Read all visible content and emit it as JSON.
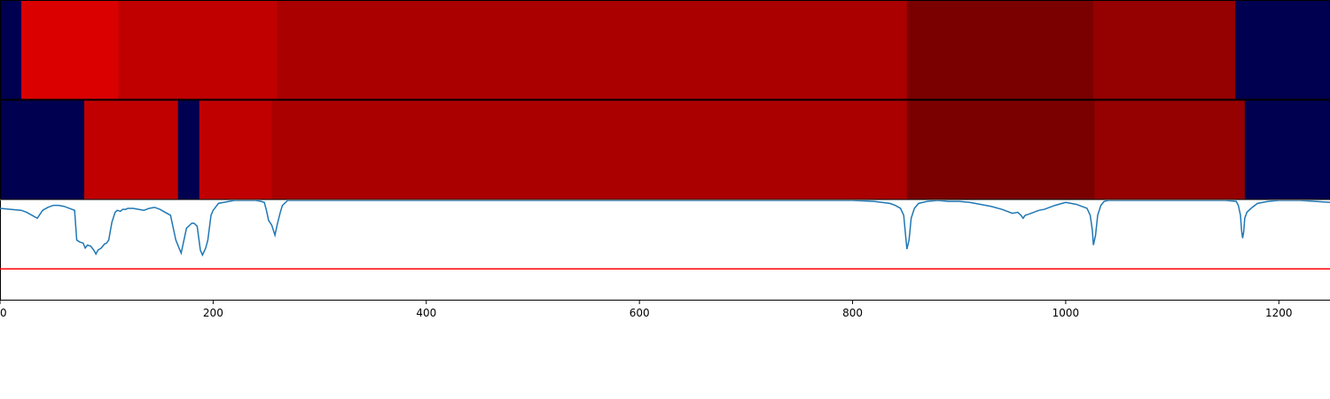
{
  "chart_data": [
    {
      "type": "heatmap",
      "panel": "top",
      "x_range": [
        0,
        1248
      ],
      "segments": [
        {
          "start": 0,
          "end": 20,
          "color": "#000050"
        },
        {
          "start": 20,
          "end": 111,
          "color": "#da0000"
        },
        {
          "start": 111,
          "end": 260,
          "color": "#c00000"
        },
        {
          "start": 260,
          "end": 851,
          "color": "#aa0000"
        },
        {
          "start": 851,
          "end": 1026,
          "color": "#7a0000"
        },
        {
          "start": 1026,
          "end": 1159,
          "color": "#950000"
        },
        {
          "start": 1159,
          "end": 1248,
          "color": "#000050"
        }
      ]
    },
    {
      "type": "heatmap",
      "panel": "middle",
      "x_range": [
        0,
        1248
      ],
      "segments": [
        {
          "start": 0,
          "end": 79,
          "color": "#000050"
        },
        {
          "start": 79,
          "end": 167,
          "color": "#c00000"
        },
        {
          "start": 167,
          "end": 187,
          "color": "#000050"
        },
        {
          "start": 187,
          "end": 255,
          "color": "#c00000"
        },
        {
          "start": 255,
          "end": 851,
          "color": "#aa0000"
        },
        {
          "start": 851,
          "end": 1027,
          "color": "#7a0000"
        },
        {
          "start": 1027,
          "end": 1168,
          "color": "#950000"
        },
        {
          "start": 1168,
          "end": 1248,
          "color": "#000050"
        }
      ]
    },
    {
      "type": "line",
      "panel": "bottom",
      "xlim": [
        0,
        1248
      ],
      "ylim": [
        0,
        1
      ],
      "line_color": "#1f77b4",
      "threshold": {
        "y": 0.31,
        "color": "#ff0000"
      },
      "x_ticks": [
        "0",
        "200",
        "400",
        "600",
        "800",
        "1000",
        "1200"
      ],
      "series": [
        {
          "x": [
            0,
            10,
            20,
            25,
            30,
            35,
            40,
            45,
            50,
            55,
            60,
            65,
            70,
            72,
            75,
            78,
            80,
            82,
            85,
            88,
            90,
            92,
            95,
            98,
            100,
            102,
            105,
            108,
            110,
            113,
            115,
            118,
            120,
            125,
            130,
            135,
            140,
            145,
            150,
            155,
            160,
            163,
            165,
            168,
            170,
            173,
            175,
            178,
            180,
            182,
            185,
            188,
            190,
            193,
            195,
            198,
            200,
            205,
            210,
            215,
            220,
            230,
            240,
            245,
            248,
            250,
            252,
            255,
            258,
            260,
            263,
            265,
            270,
            280,
            300,
            400,
            500,
            600,
            700,
            800,
            820,
            835,
            840,
            845,
            848,
            850,
            851,
            853,
            855,
            858,
            862,
            870,
            880,
            890,
            900,
            910,
            920,
            930,
            940,
            945,
            950,
            955,
            958,
            960,
            962,
            965,
            970,
            975,
            980,
            985,
            990,
            1000,
            1010,
            1015,
            1020,
            1023,
            1025,
            1026,
            1028,
            1030,
            1033,
            1036,
            1040,
            1050,
            1100,
            1150,
            1160,
            1162,
            1164,
            1165,
            1166,
            1167,
            1168,
            1170,
            1172,
            1175,
            1180,
            1190,
            1200,
            1220,
            1248
          ],
          "y": [
            0.92,
            0.91,
            0.9,
            0.88,
            0.85,
            0.82,
            0.9,
            0.93,
            0.95,
            0.95,
            0.94,
            0.92,
            0.9,
            0.6,
            0.58,
            0.57,
            0.52,
            0.55,
            0.54,
            0.5,
            0.46,
            0.5,
            0.52,
            0.56,
            0.57,
            0.6,
            0.78,
            0.88,
            0.9,
            0.89,
            0.91,
            0.91,
            0.92,
            0.92,
            0.91,
            0.9,
            0.92,
            0.93,
            0.91,
            0.88,
            0.85,
            0.7,
            0.6,
            0.52,
            0.47,
            0.62,
            0.72,
            0.75,
            0.77,
            0.77,
            0.74,
            0.5,
            0.45,
            0.52,
            0.6,
            0.85,
            0.9,
            0.97,
            0.98,
            0.99,
            1.0,
            1.0,
            1.0,
            0.99,
            0.98,
            0.9,
            0.8,
            0.75,
            0.65,
            0.75,
            0.88,
            0.95,
            1.0,
            1.0,
            1.0,
            1.0,
            1.0,
            1.0,
            1.0,
            1.0,
            0.99,
            0.97,
            0.95,
            0.92,
            0.85,
            0.62,
            0.51,
            0.6,
            0.82,
            0.92,
            0.97,
            0.99,
            1.0,
            0.99,
            0.99,
            0.98,
            0.96,
            0.94,
            0.91,
            0.89,
            0.87,
            0.88,
            0.85,
            0.82,
            0.85,
            0.86,
            0.88,
            0.9,
            0.91,
            0.93,
            0.95,
            0.98,
            0.96,
            0.94,
            0.92,
            0.85,
            0.7,
            0.55,
            0.65,
            0.85,
            0.95,
            0.99,
            1.0,
            1.0,
            1.0,
            1.0,
            0.99,
            0.95,
            0.85,
            0.7,
            0.62,
            0.68,
            0.82,
            0.88,
            0.9,
            0.93,
            0.97,
            0.99,
            1.0,
            1.0,
            0.98
          ]
        }
      ]
    }
  ]
}
